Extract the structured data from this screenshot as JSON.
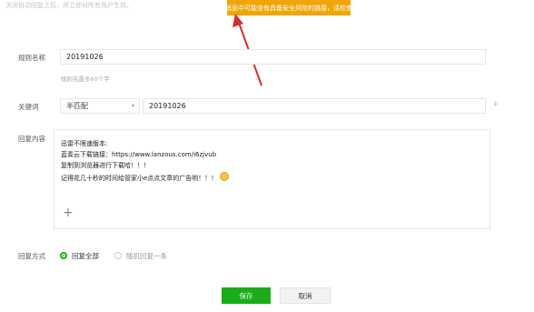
{
  "top_tip_faded": "关闭自动回复之后，将立即对所有用户生效。",
  "warning_banner": "消息中可能含有具备安全风险的链接，请检查",
  "rule_name": {
    "label": "规则名称",
    "value": "20191026",
    "hint": "规则名最多60个字"
  },
  "keyword": {
    "label": "关键词",
    "match_mode": "半匹配",
    "value": "20191026"
  },
  "reply_content": {
    "label": "回复内容",
    "lines": [
      "迅雷不限速版本:",
      "蓝奏云下载链接：https://www.lanzous.com/i6zjvub",
      "复制到浏览器进行下载哈！！！",
      "记得花几十秒的时间给管家小e点点文章的广告哟！！！"
    ],
    "emoji": "smile-emoji",
    "add_symbol": "+"
  },
  "reply_mode": {
    "label": "回复方式",
    "options": [
      "回复全部",
      "随机回复一条"
    ],
    "selected": "回复全部"
  },
  "actions": {
    "save": "保存",
    "cancel": "取消"
  },
  "colors": {
    "accent": "#1aad19",
    "warning": "#f0a60a",
    "arrow": "#d62f2f"
  }
}
